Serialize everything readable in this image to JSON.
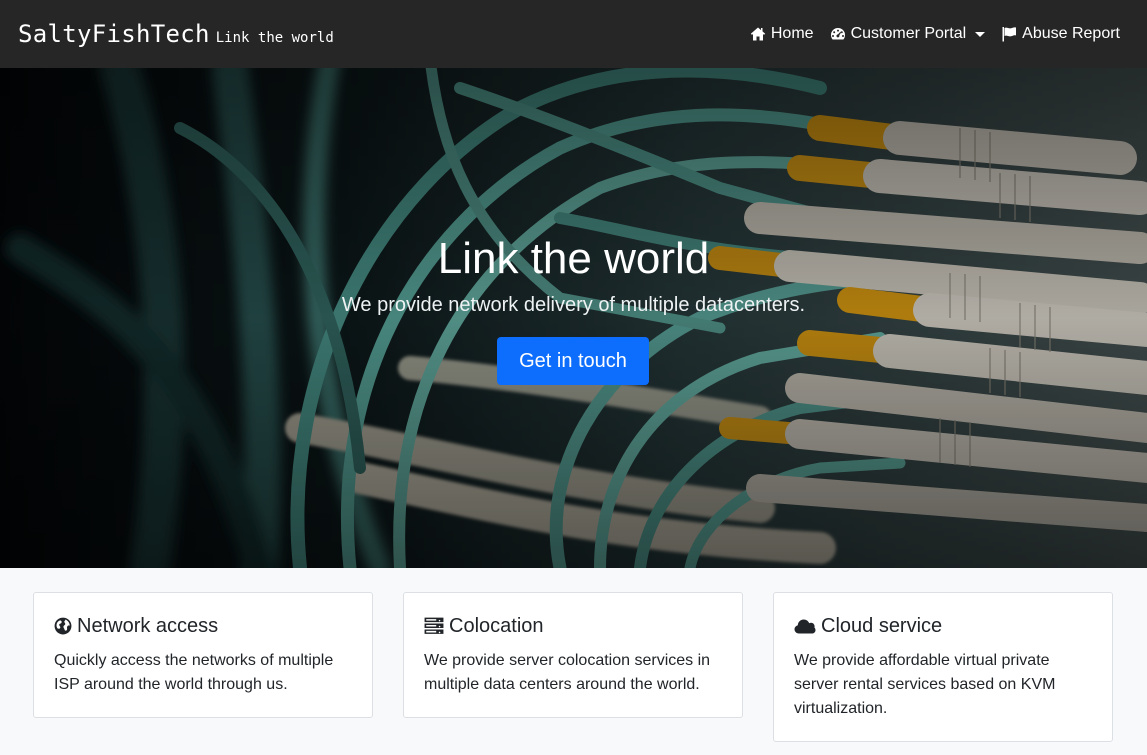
{
  "navbar": {
    "brand_name": "SaltyFishTech",
    "brand_tagline": "Link the world",
    "links": [
      {
        "label": "Home",
        "icon": "home-icon"
      },
      {
        "label": "Customer Portal",
        "icon": "dashboard-icon",
        "dropdown": true
      },
      {
        "label": "Abuse Report",
        "icon": "flag-icon"
      }
    ]
  },
  "hero": {
    "title": "Link the world",
    "subtitle": "We provide network delivery of multiple datacenters.",
    "button_label": "Get in touch"
  },
  "features": [
    {
      "icon": "globe-icon",
      "title": "Network access",
      "text": "Quickly access the networks of multiple ISP around the world through us."
    },
    {
      "icon": "server-icon",
      "title": "Colocation",
      "text": "We provide server colocation services in multiple data centers around the world."
    },
    {
      "icon": "cloud-icon",
      "title": "Cloud service",
      "text": "We provide affordable virtual private server rental services based on KVM virtualization."
    }
  ],
  "colors": {
    "navbar_bg": "#262626",
    "primary": "#0d6efd",
    "cable_teal": "#5fb3a7",
    "connector_yellow": "#e8a515",
    "page_bg": "#f8f9fa"
  }
}
